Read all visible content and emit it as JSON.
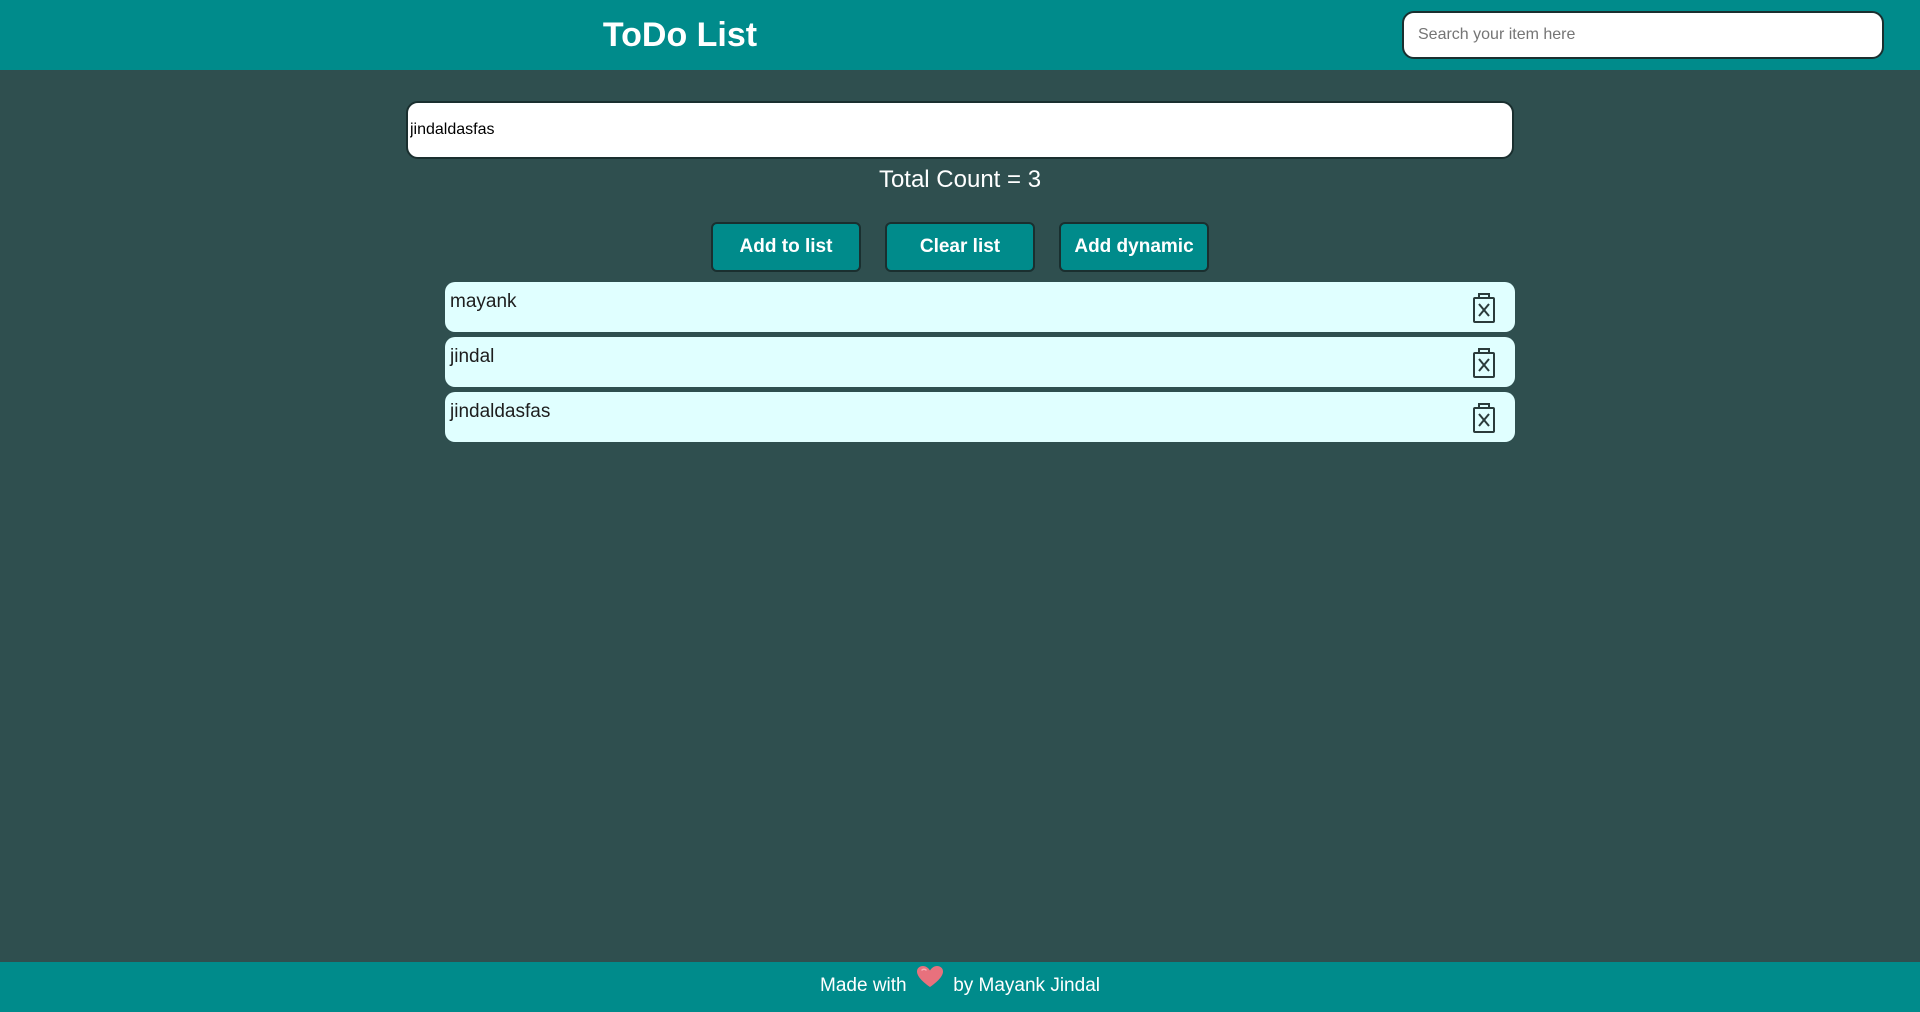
{
  "header": {
    "title": "ToDo List",
    "search_placeholder": "Search your item here",
    "search_value": ""
  },
  "input": {
    "value": "jindaldasfas"
  },
  "count": {
    "text": "Total Count = 3"
  },
  "buttons": {
    "add_label": "Add to list",
    "clear_label": "Clear list",
    "dynamic_label": "Add dynamic"
  },
  "items": [
    {
      "text": "mayank",
      "delete_icon": "trash-x-icon"
    },
    {
      "text": "jindal",
      "delete_icon": "trash-x-icon"
    },
    {
      "text": "jindaldasfas",
      "delete_icon": "trash-x-icon"
    }
  ],
  "footer": {
    "prefix": "Made with",
    "icon": "heart-icon",
    "suffix": "by Mayank Jindal"
  },
  "colors": {
    "header_bg": "#008b8b",
    "page_bg": "#2f4f4f",
    "item_bg": "#e0ffff",
    "heart": "#e8717d"
  }
}
